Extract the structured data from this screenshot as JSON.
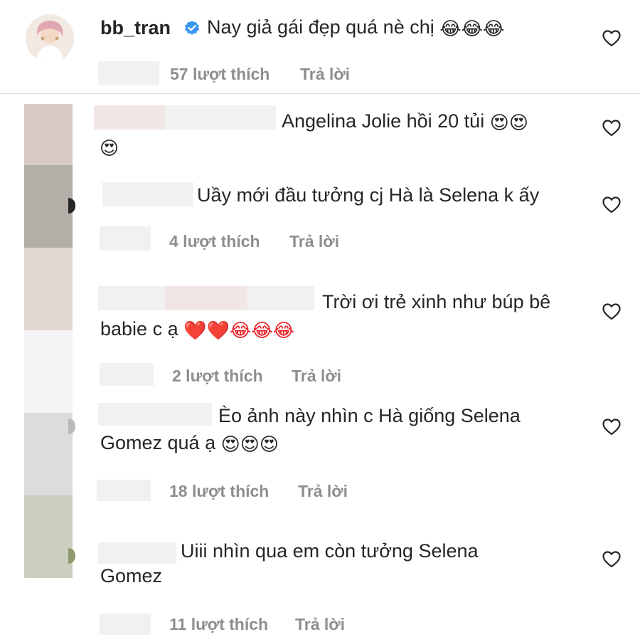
{
  "colors": {
    "text": "#262626",
    "secondary": "#8e8e8e",
    "verified": "#3897f0",
    "heart_red": "#ed1c24",
    "divider": "#dbdbdb"
  },
  "comments": [
    {
      "username": "bb_tran",
      "verified": true,
      "text": "Nay giả gái đẹp quá nè chị",
      "emoji": "😂😂😂",
      "likes": "57 lượt thích",
      "reply": "Trả lời"
    },
    {
      "username": "",
      "text_line1": "Angelina Jolie hồi 20 tủi",
      "emoji_line1": "😍😍",
      "emoji_line2": "😍"
    },
    {
      "username": "",
      "text": "Uầy mới đầu tưởng cj Hà là Selena k ấy",
      "likes": "4 lượt thích",
      "reply": "Trả lời"
    },
    {
      "username": "",
      "text_line1": "Trời ơi trẻ xinh như búp bê",
      "text_line2": "babie c ạ",
      "emoji_line2": "❤️❤️😂😂😂",
      "likes": "2 lượt thích",
      "reply": "Trả lời"
    },
    {
      "username": "",
      "text_line1": "Èo ảnh này nhìn c Hà giống Selena",
      "text_line2": "Gomez quá ạ",
      "emoji_line2": "😍😍😍",
      "likes": "18 lượt thích",
      "reply": "Trả lời"
    },
    {
      "username": "",
      "text_line1": "Uiii nhìn qua em còn tưởng Selena",
      "text_line2": "Gomez",
      "likes": "11 lượt thích",
      "reply": "Trả lời"
    }
  ],
  "icons": {
    "like": "heart-outline-icon",
    "verified": "verified-badge-icon"
  }
}
